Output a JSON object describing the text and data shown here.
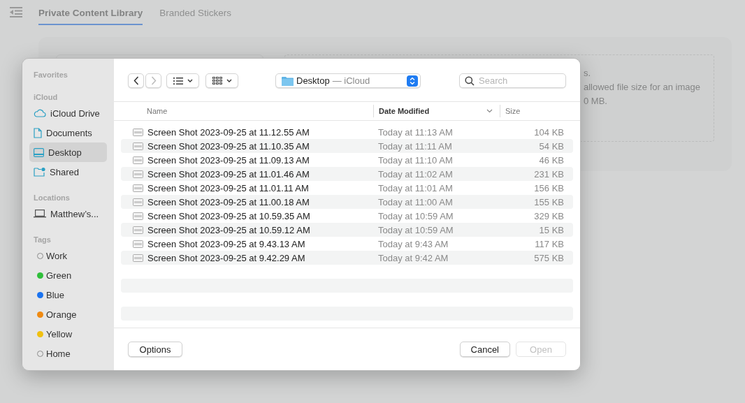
{
  "page": {
    "tabs": [
      {
        "label": "Private Content Library",
        "selected": true
      },
      {
        "label": "Branded Stickers",
        "selected": false
      }
    ],
    "upload_hint_lines": [
      "s.",
      "allowed file size for an image",
      "0 MB."
    ]
  },
  "dialog": {
    "sidebar": [
      {
        "heading": "Favorites"
      },
      {
        "heading": "iCloud",
        "items": [
          {
            "label": "iCloud Drive",
            "kind": "cloud",
            "selected": false
          },
          {
            "label": "Documents",
            "kind": "document",
            "selected": false
          },
          {
            "label": "Desktop",
            "kind": "desktop",
            "selected": true
          },
          {
            "label": "Shared",
            "kind": "shared",
            "selected": false
          }
        ]
      },
      {
        "heading": "Locations",
        "items": [
          {
            "label": "Matthew’s...",
            "kind": "laptop",
            "selected": false
          }
        ]
      },
      {
        "heading": "Tags",
        "items": [
          {
            "label": "Work",
            "kind": "tag",
            "filled": false,
            "selected": false
          },
          {
            "label": "Green",
            "kind": "tag",
            "filled": true,
            "color": "#2fbf3a",
            "selected": false
          },
          {
            "label": "Blue",
            "kind": "tag",
            "filled": true,
            "color": "#1a73f0",
            "selected": false
          },
          {
            "label": "Orange",
            "kind": "tag",
            "filled": true,
            "color": "#ef8a12",
            "selected": false
          },
          {
            "label": "Yellow",
            "kind": "tag",
            "filled": true,
            "color": "#f0c010",
            "selected": false
          },
          {
            "label": "Home",
            "kind": "tag",
            "filled": false,
            "selected": false
          }
        ]
      }
    ],
    "location": {
      "folder": "Desktop",
      "place": "— iCloud"
    },
    "search": {
      "placeholder": "Search"
    },
    "columns": [
      {
        "label": "Name",
        "sorted": false
      },
      {
        "label": "Date Modified",
        "sorted": true
      },
      {
        "label": "Size",
        "sorted": false
      }
    ],
    "files": [
      {
        "name": "Screen Shot 2023-09-25 at 11.12.55 AM",
        "modified": "Today at 11:13 AM",
        "size": "104 KB"
      },
      {
        "name": "Screen Shot 2023-09-25 at 11.10.35 AM",
        "modified": "Today at 11:11 AM",
        "size": "54 KB"
      },
      {
        "name": "Screen Shot 2023-09-25 at 11.09.13 AM",
        "modified": "Today at 11:10 AM",
        "size": "46 KB"
      },
      {
        "name": "Screen Shot 2023-09-25 at 11.01.46 AM",
        "modified": "Today at 11:02 AM",
        "size": "231 KB"
      },
      {
        "name": "Screen Shot 2023-09-25 at 11.01.11 AM",
        "modified": "Today at 11:01 AM",
        "size": "156 KB"
      },
      {
        "name": "Screen Shot 2023-09-25 at 11.00.18 AM",
        "modified": "Today at 11:00 AM",
        "size": "155 KB"
      },
      {
        "name": "Screen Shot 2023-09-25 at 10.59.35 AM",
        "modified": "Today at 10:59 AM",
        "size": "329 KB"
      },
      {
        "name": "Screen Shot 2023-09-25 at 10.59.12 AM",
        "modified": "Today at 10:59 AM",
        "size": "15 KB"
      },
      {
        "name": "Screen Shot 2023-09-25 at 9.43.13 AM",
        "modified": "Today at 9:43 AM",
        "size": "117 KB"
      },
      {
        "name": "Screen Shot 2023-09-25 at 9.42.29 AM",
        "modified": "Today at 9:42 AM",
        "size": "575 KB"
      }
    ],
    "buttons": [
      {
        "label": "Options",
        "disabled": false
      },
      {
        "label": "Cancel",
        "disabled": false
      },
      {
        "label": "Open",
        "disabled": true
      }
    ]
  }
}
